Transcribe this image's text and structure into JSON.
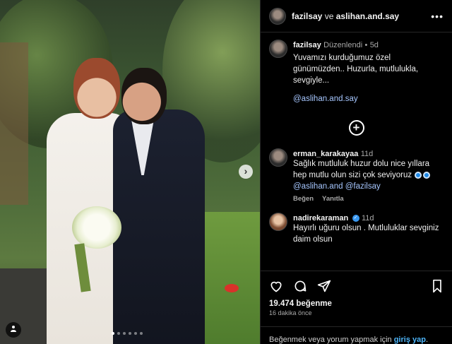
{
  "header": {
    "user1": "fazilsay",
    "conjunction": "ve",
    "user2": "aslihan.and.say",
    "more": "•••"
  },
  "caption": {
    "username": "fazilsay",
    "edited": "Düzenlendi",
    "separator": "•",
    "time": "5d",
    "text": "Yuvamızı kurduğumuz özel günümüzden.. Huzurla, mutlulukla, sevgiyle...",
    "mention": "@aslihan.and.say"
  },
  "comments": [
    {
      "username": "erman_karakayaa",
      "time": "11d",
      "text": "Sağlık mutluluk huzur dolu nice yıllara hep mutlu olun sizi çok seviyoruz",
      "mention1": "@aslihan.and",
      "mention2": "@fazilsay",
      "like_label": "Beğen",
      "reply_label": "Yanıtla"
    },
    {
      "username": "nadirekaraman",
      "time": "11d",
      "text": "Hayırlı uğuru olsun . Mutluluklar sevginiz daim olsun"
    }
  ],
  "stats": {
    "likes": "19.474 beğenme",
    "ago": "16 dakika önce"
  },
  "login": {
    "prefix": "Beğenmek veya yorum yapmak için",
    "link": "giriş yap",
    "suffix": "."
  },
  "photo": {
    "next_arrow": "›",
    "slide_count": 6,
    "active_slide": 1
  },
  "colors": {
    "accent_link": "#4db5f9",
    "verified": "#3897f0",
    "background": "#000000"
  },
  "icons": [
    "heart-icon",
    "comment-icon",
    "share-icon",
    "bookmark-icon",
    "user-tag-icon",
    "chevron-right-icon",
    "more-icon",
    "add-circle-icon"
  ]
}
